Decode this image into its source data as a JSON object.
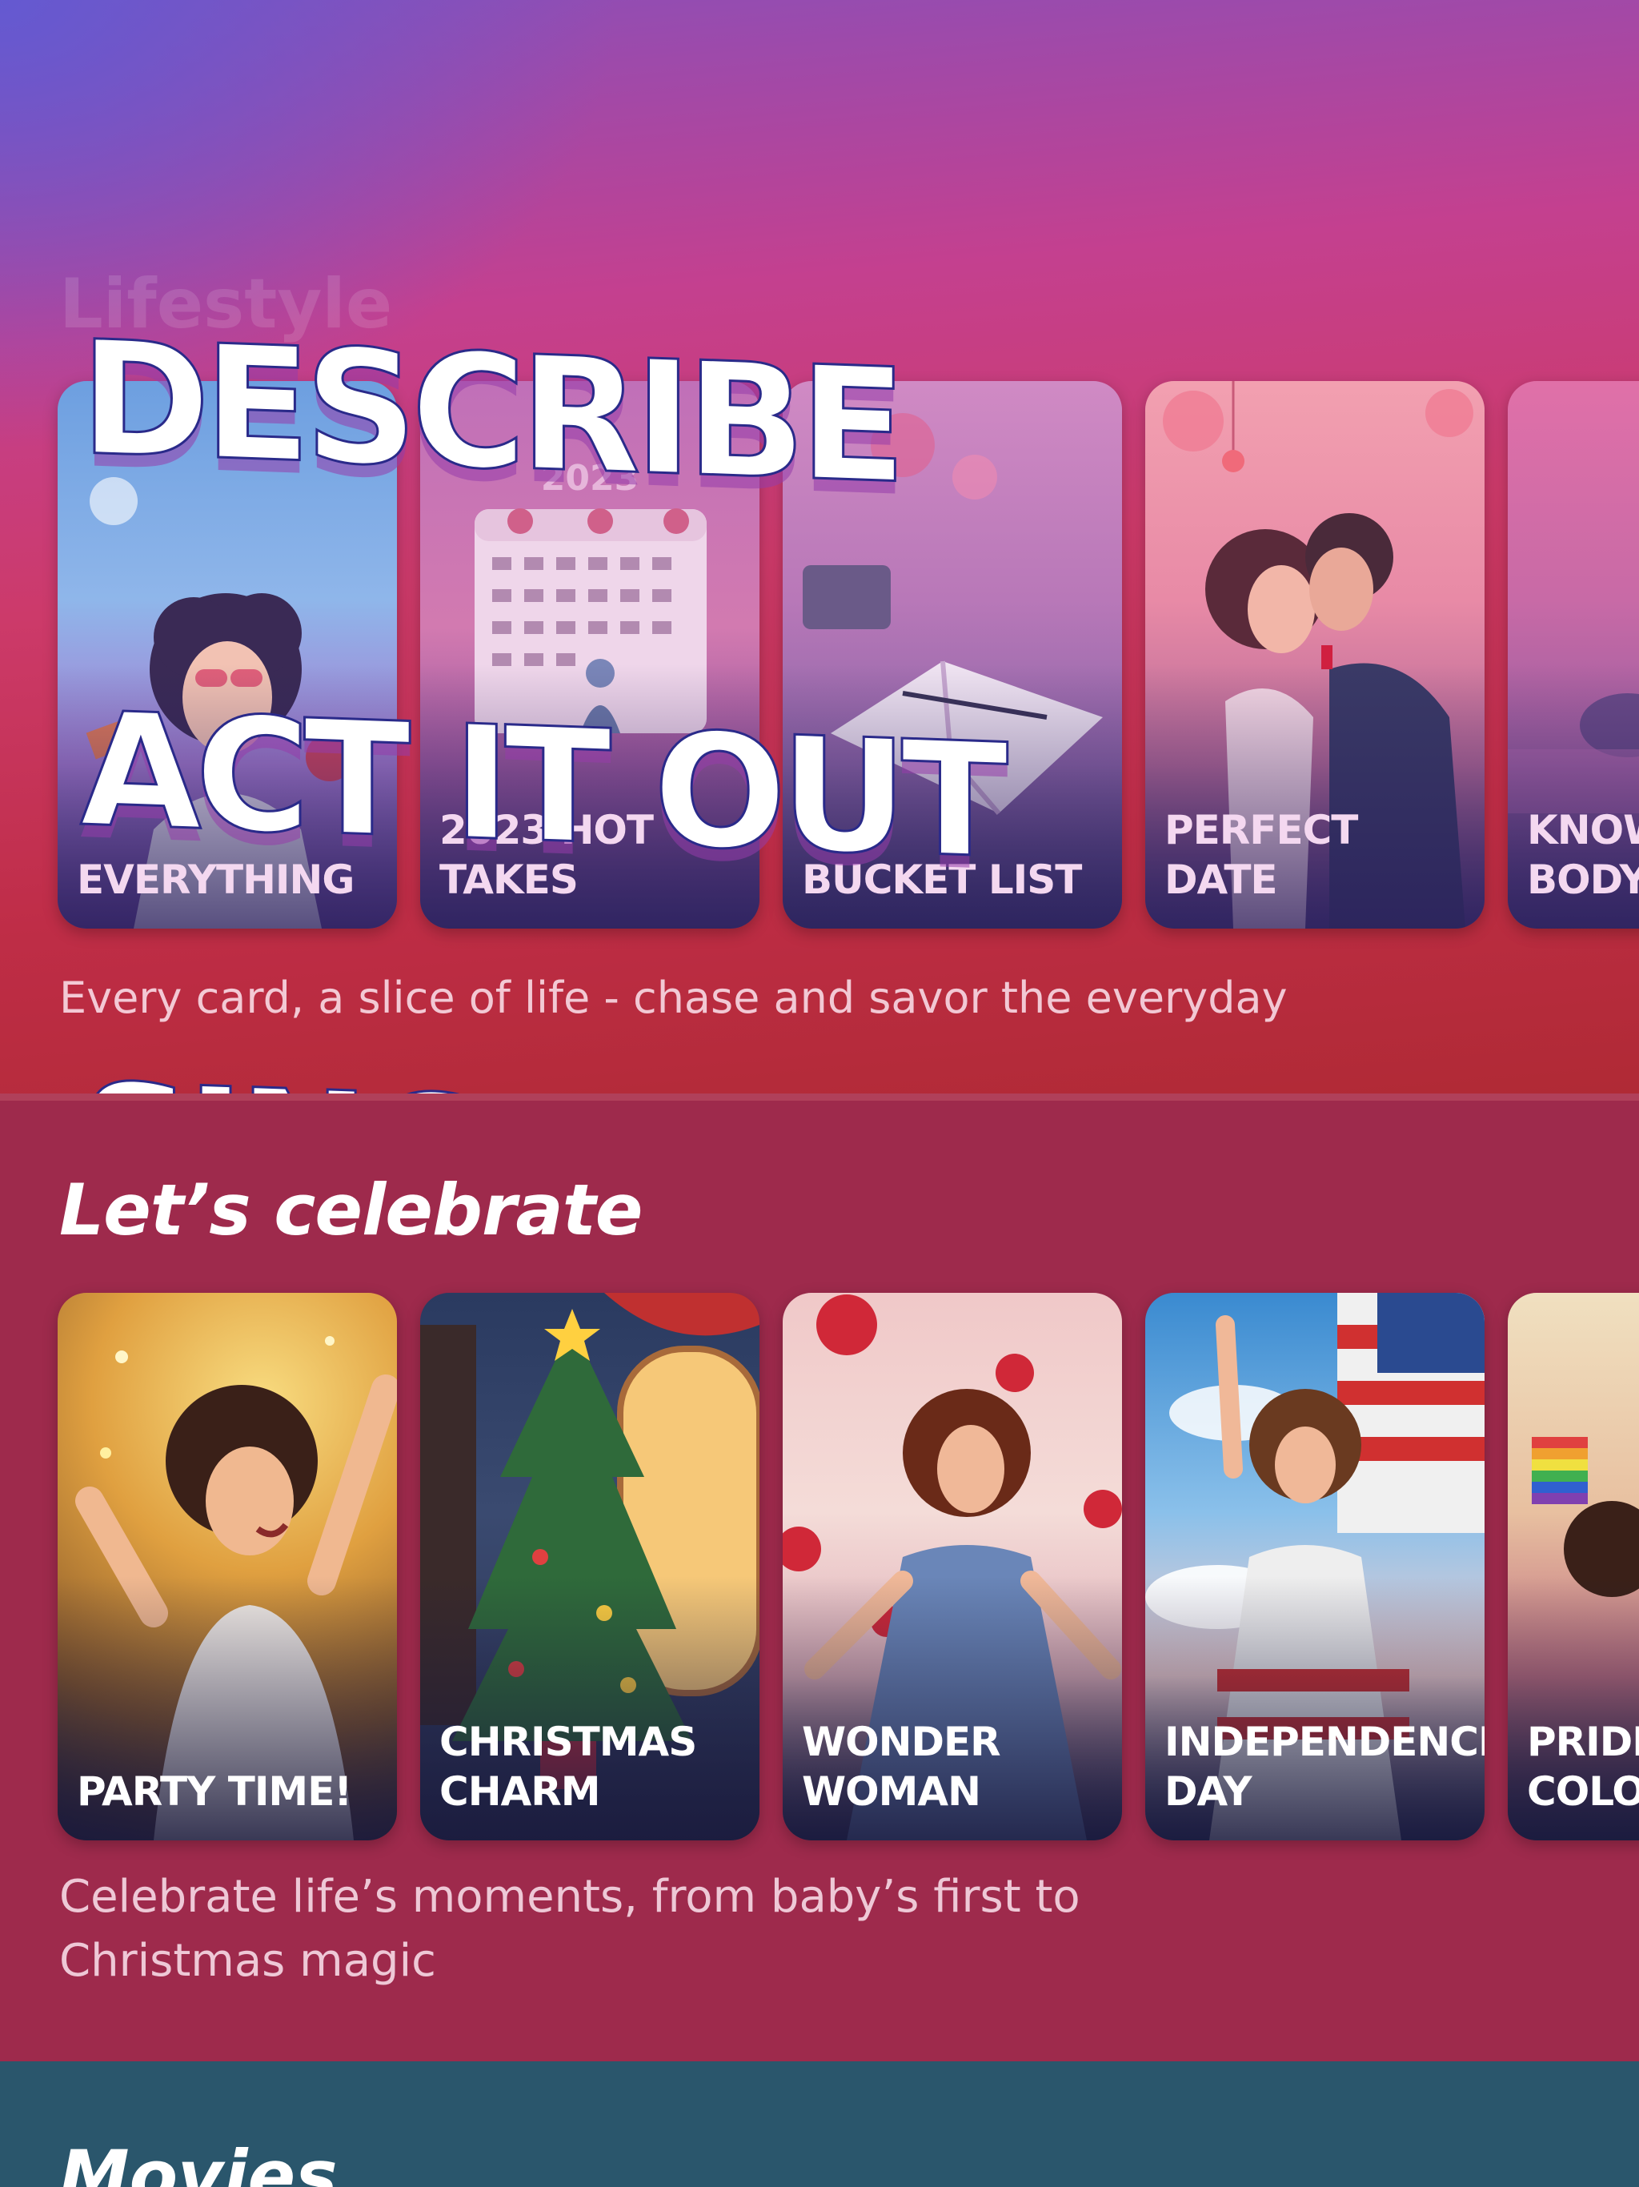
{
  "overlay": {
    "lines": [
      "DESCRIBE",
      "ACT IT OUT",
      "SING"
    ]
  },
  "lifestyle": {
    "title": "Lifestyle",
    "subtitle": "Every card, a slice of life - chase and savor the everyday",
    "cards": [
      {
        "label": "EVERYTHING"
      },
      {
        "label": "2023 HOT\nTAKES",
        "image_text": "2023"
      },
      {
        "label": "BUCKET LIST"
      },
      {
        "label": "PERFECT DATE"
      },
      {
        "label": "KNOW\nBODY"
      }
    ]
  },
  "celebrate": {
    "title": "Let’s celebrate",
    "subtitle": "Celebrate life’s moments, from baby’s first to\nChristmas magic",
    "cards": [
      {
        "label": "PARTY TIME!"
      },
      {
        "label": "CHRISTMAS\nCHARM"
      },
      {
        "label": "WONDER\nWOMAN"
      },
      {
        "label": "INDEPENDENCE\nDAY"
      },
      {
        "label": "PRIDE\nCOLO"
      }
    ]
  },
  "movies": {
    "title": "Movies"
  },
  "colors": {
    "lifestyle_bg_top": "#8a4fb8",
    "lifestyle_bg_bottom": "#b02a35",
    "celebrate_bg": "#9e2a4c",
    "movies_bg": "#2a566c"
  }
}
